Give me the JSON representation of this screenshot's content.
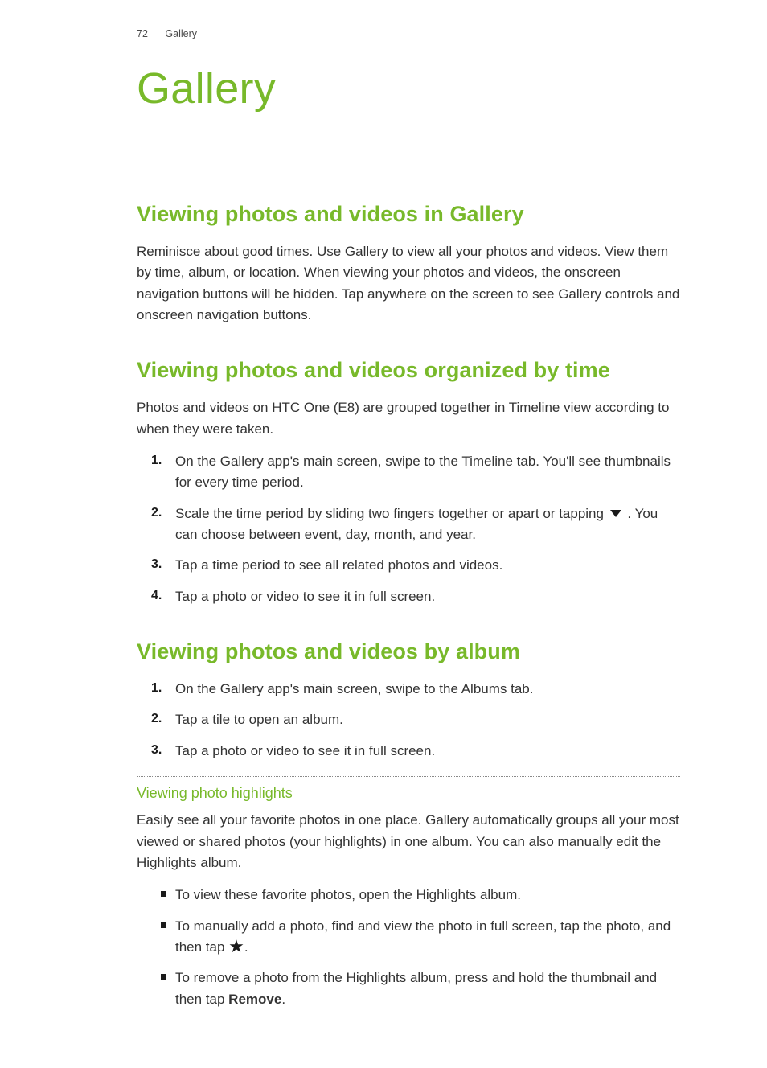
{
  "header": {
    "page_number": "72",
    "chapter_ref": "Gallery"
  },
  "chapter_title": "Gallery",
  "sections": {
    "s1": {
      "title": "Viewing photos and videos in Gallery",
      "p1": "Reminisce about good times. Use Gallery to view all your photos and videos. View them by time, album, or location. When viewing your photos and videos, the onscreen navigation buttons will be hidden. Tap anywhere on the screen to see Gallery controls and onscreen navigation buttons."
    },
    "s2": {
      "title": "Viewing photos and videos organized by time",
      "p1": "Photos and videos on HTC One (E8) are grouped together in Timeline view according to when they were taken.",
      "step1": "On the Gallery app's main screen, swipe to the Timeline tab. You'll see thumbnails for every time period.",
      "step2a": "Scale the time period by sliding two fingers together or apart or tapping ",
      "step2b": " . You can choose between event, day, month, and year.",
      "step3": "Tap a time period to see all related photos and videos.",
      "step4": "Tap a photo or video to see it in full screen."
    },
    "s3": {
      "title": "Viewing photos and videos by album",
      "step1": "On the Gallery app's main screen, swipe to the Albums tab.",
      "step2": "Tap a tile to open an album.",
      "step3": "Tap a photo or video to see it in full screen.",
      "sub": {
        "title": "Viewing photo highlights",
        "p1": "Easily see all your favorite photos in one place. Gallery automatically groups all your most viewed or shared photos (your highlights) in one album. You can also manually edit the Highlights album.",
        "b1": "To view these favorite photos, open the Highlights album.",
        "b2a": "To manually add a photo, find and view the photo in full screen, tap the photo, and then tap ",
        "b2b": ".",
        "b3a": "To remove a photo from the Highlights album, press and hold the thumbnail and then tap ",
        "b3_label": "Remove",
        "b3b": "."
      }
    }
  }
}
